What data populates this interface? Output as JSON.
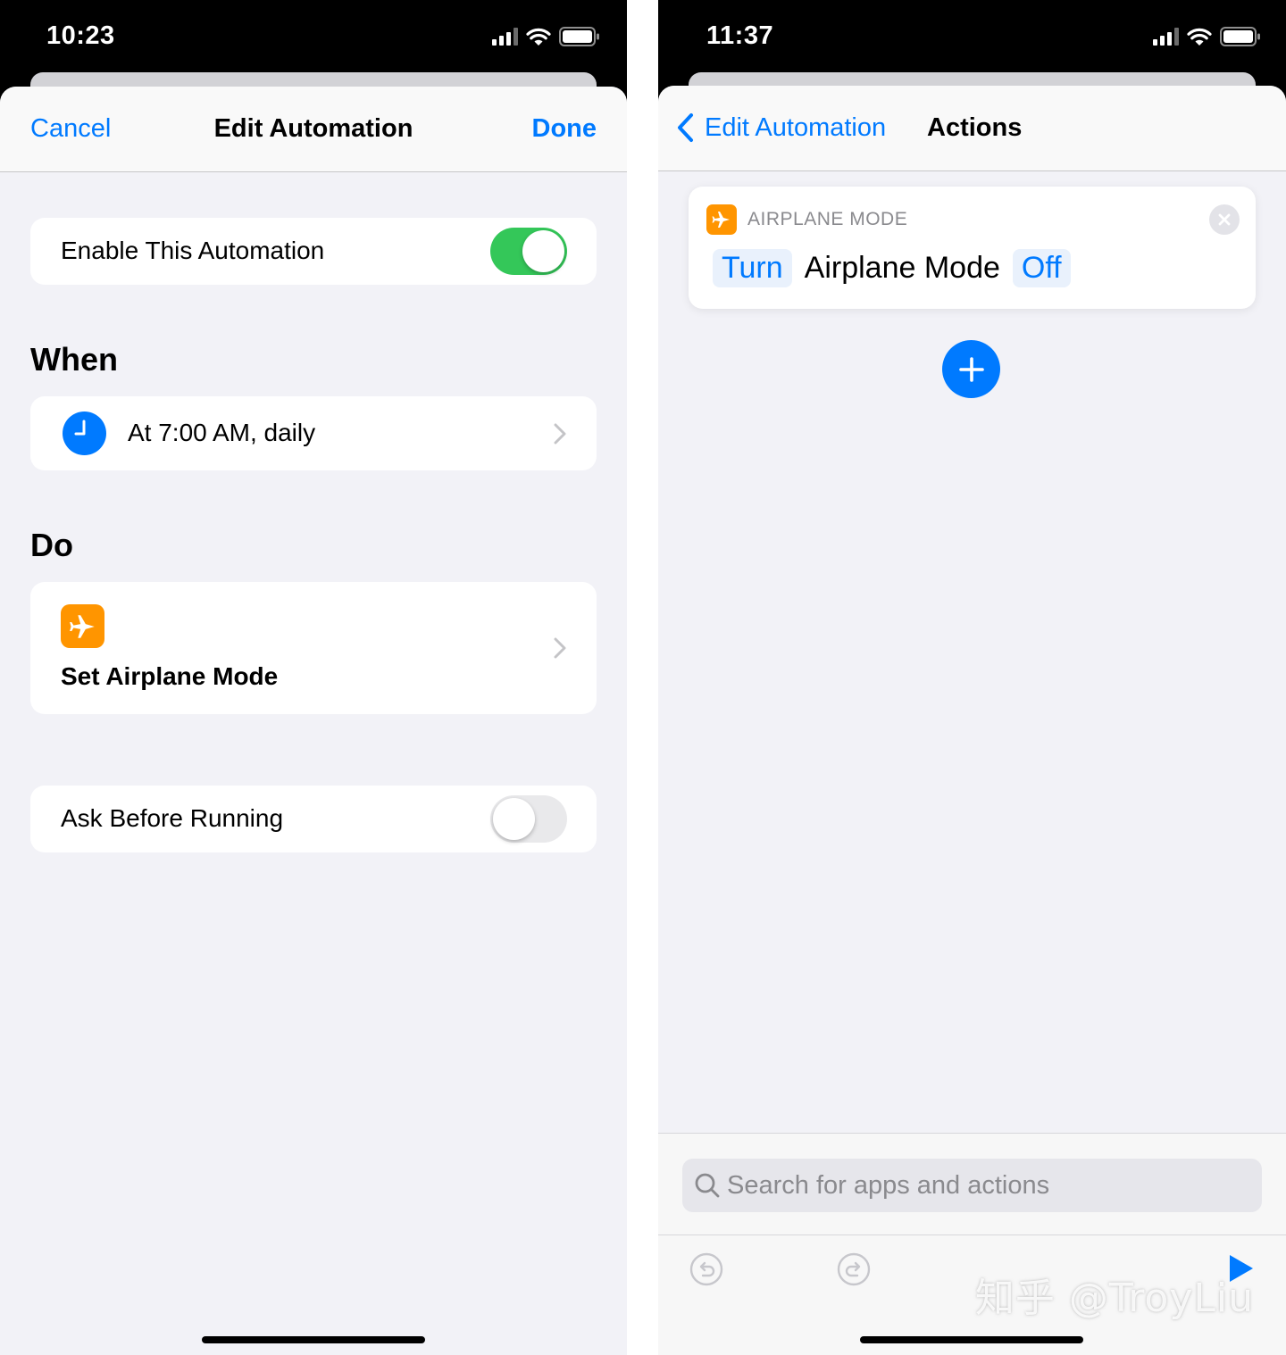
{
  "left": {
    "status": {
      "time": "10:23"
    },
    "nav": {
      "cancel": "Cancel",
      "title": "Edit Automation",
      "done": "Done"
    },
    "enable": {
      "label": "Enable This Automation",
      "on": true
    },
    "when": {
      "header": "When",
      "trigger": "At 7:00 AM, daily",
      "icon": "clock-icon"
    },
    "do": {
      "header": "Do",
      "action": "Set Airplane Mode",
      "icon": "airplane-icon"
    },
    "ask": {
      "label": "Ask Before Running",
      "on": false
    }
  },
  "right": {
    "status": {
      "time": "11:37"
    },
    "nav": {
      "back": "Edit Automation",
      "title": "Actions"
    },
    "action_card": {
      "category": "AIRPLANE MODE",
      "verb": "Turn",
      "object": "Airplane Mode",
      "state": "Off"
    },
    "search": {
      "placeholder": "Search for apps and actions"
    }
  },
  "watermark": "知乎 @TroyLiu",
  "colors": {
    "accent": "#007aff",
    "toggle_on": "#34c759",
    "airplane_orange": "#ff9500",
    "background": "#f2f2f7"
  }
}
